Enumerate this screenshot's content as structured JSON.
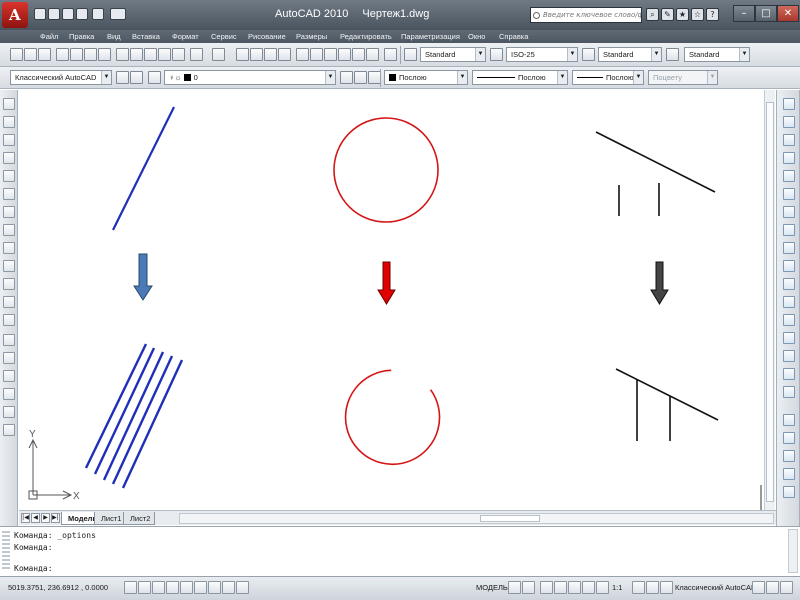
{
  "window": {
    "app_title": "AutoCAD 2010",
    "document_title": "Чертеж1.dwg",
    "search_placeholder": "Введите ключевое слово/фразу"
  },
  "menu": [
    "Файл",
    "Правка",
    "Вид",
    "Вставка",
    "Формат",
    "Сервис",
    "Рисование",
    "Размеры",
    "Редактировать",
    "Параметризация",
    "Окно",
    "Справка"
  ],
  "toolbar_styles": {
    "text_style": "Standard",
    "dim_style": "ISO-25",
    "table_style": "Standard",
    "multileader_style": "Standard"
  },
  "toolbar_layers": {
    "workspace": "Классический AutoCAD",
    "layer": "0",
    "color": "Послою",
    "linetype": "Послою",
    "lineweight": "Послою",
    "plotstyle": "Поцвету"
  },
  "tabs": [
    "Модель",
    "Лист1",
    "Лист2"
  ],
  "command_lines": [
    "Команда: _options",
    "Команда:",
    "Команда:"
  ],
  "status": {
    "coordinates": "5019.3751, 236.6912 , 0.0000",
    "model_label": "МОДЕЛЬ",
    "scale": "1:1",
    "workspace": "Классический AutoCAD"
  },
  "ucs": {
    "x_label": "X",
    "y_label": "Y"
  },
  "colors": {
    "blue_lines": "#1f2fb8",
    "red_circle": "#d41515",
    "black_lines": "#111111",
    "blue_arrow": "#4a7bb7",
    "red_arrow": "#e00000",
    "gray_arrow": "#444444"
  }
}
